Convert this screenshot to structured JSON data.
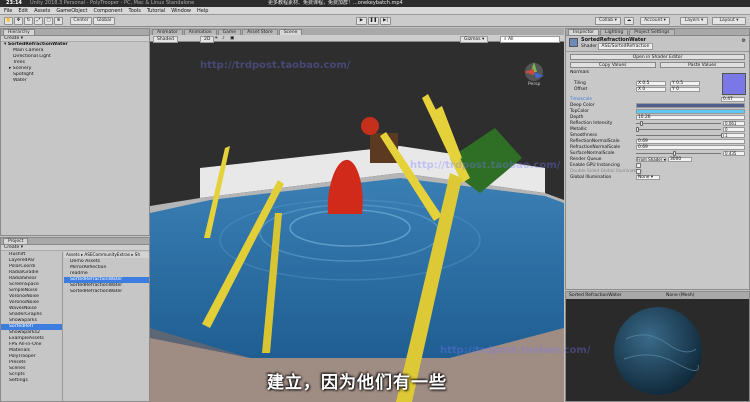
{
  "titlebar": {
    "clock": "23:14",
    "title": "Unity 2018.3 Personal - PolyTrooper - PC, Mac & Linux Standalone",
    "watermark_title": "更多教程素材、免费课程，免费加群！...onekeybatch.mp4"
  },
  "menu": [
    "File",
    "Edit",
    "Assets",
    "GameObject",
    "Component",
    "Tools",
    "Tutorial",
    "Window",
    "Help"
  ],
  "toolbar": {
    "center": "Center",
    "global": "Global",
    "collab": "Collab ▾",
    "account": "Account ▾",
    "layers": "Layers ▾",
    "layout": "Layout ▾"
  },
  "hierarchy": {
    "tab": "Hierarchy",
    "create": "Create ▾",
    "root": "SortedRefractionWater",
    "items": [
      "Main Camera",
      "Directional Light",
      "Trees",
      "Scenery",
      "Spotlight",
      "Water"
    ]
  },
  "project": {
    "tab": "Project",
    "create": "Create ▾",
    "folders": [
      "Hushift",
      "LayeredPar",
      "PolarCoordi",
      "RadialGradie",
      "RadialShear",
      "ScreenSpace",
      "SimpleNoise",
      "VoronoiNoise",
      "VoronoiNoise",
      "WavesNoise",
      "ShaderGraphs",
      "ShowSparks",
      "SortedRefr",
      "ShowSparks2",
      "ExampleAssets",
      "FPS All-in-One",
      "Materials",
      "PolyTrooper",
      "Presets",
      "Scenes",
      "Scripts",
      "Settings"
    ],
    "breadcrumb": "Assets ▸ ASECommunityExtras ▸ Sh",
    "files": [
      "Demo Assets",
      "MirrorReflection",
      "readme",
      "SortedRefractionWater",
      "SortedRefractionWater",
      "SortedRefractionWater"
    ]
  },
  "scene": {
    "tabs": [
      "Animator",
      "Animation",
      "Game",
      "Asset Store",
      "Scene"
    ],
    "shading": "Shaded",
    "mode": "2D",
    "gizmos": "Gizmos ▾",
    "all": "All",
    "persp": "Persp",
    "watermark": "http://trdpost.taobao.com/"
  },
  "subtitle": "建立，因为他们有一些",
  "inspector": {
    "tabs": [
      "Inspector",
      "Lighting",
      "Project Settings"
    ],
    "name": "SortedRefractionWater",
    "shader_label": "Shader",
    "shader": "ASE/SortedRefraction",
    "open_editor": "Open in Shader Editor",
    "copy": "Copy Values",
    "paste": "Paste Values",
    "normals": "Normals",
    "tiling_label": "Tiling",
    "offset_label": "Offset",
    "tiling": [
      "X 0.5",
      "Y 0.5"
    ],
    "offset": [
      "X 0",
      "Y 0"
    ],
    "props": [
      {
        "label": "Timescale",
        "value": "0.47"
      },
      {
        "label": "Deep Color",
        "value": ""
      },
      {
        "label": "TopColor",
        "value": ""
      },
      {
        "label": "Depth",
        "value": "10.26"
      },
      {
        "label": "Reflection Intensity",
        "value": "0.061",
        "slider": 0.05
      },
      {
        "label": "Metallic",
        "value": "0",
        "slider": 0.0
      },
      {
        "label": "Smoothness",
        "value": "1",
        "slider": 1.0
      },
      {
        "label": "ReflectionNormalScale",
        "value": "0.69"
      },
      {
        "label": "RefractionNormalScale",
        "value": "0.69"
      },
      {
        "label": "SurfaceNormalScale",
        "value": "0.435",
        "slider": 0.435
      },
      {
        "label": "Render Queue",
        "value": "3000",
        "extra": "From Shader ▾"
      },
      {
        "label": "Enable GPU Instancing",
        "value": ""
      },
      {
        "label": "Double Sided Global Illumination",
        "value": ""
      },
      {
        "label": "Global Illumination",
        "value": "None ▾"
      }
    ],
    "preview_title": "Sorted RefractionWater",
    "preview_mesh": "None (Mesh)"
  },
  "colors": {
    "deep": "#4f5f8a",
    "top": "#5ec8f5",
    "accent": "#3e7de0"
  }
}
